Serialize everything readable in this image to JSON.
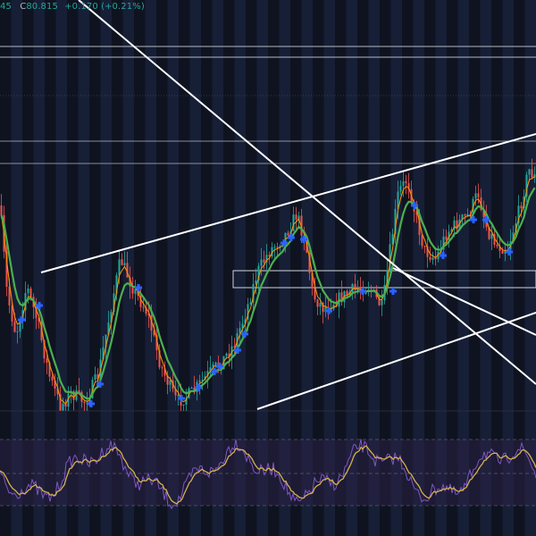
{
  "legend": {
    "open_partial": "45",
    "close_label": "C",
    "close_value": "80.815",
    "change": "+0.170 (+0.21%)"
  },
  "colors": {
    "background": "#131722",
    "band_dark": "#0f1320",
    "band_light": "#18203a",
    "candle_up": "#26a69a",
    "candle_down": "#ef5350",
    "ma_fast": "#ff9800",
    "ma_slow": "#4caf50",
    "signal_marker": "#2962ff",
    "trendline": "#ffffff",
    "oscillator_line": "#7e57c2",
    "oscillator_signal": "#d4b24c",
    "oscillator_band": "#2a2146"
  },
  "icons": {
    "signal_marker": "plus-cross-icon"
  },
  "oscillator": {
    "band_upper_level": 70,
    "band_lower_level": 30,
    "mid_level": 50
  }
}
